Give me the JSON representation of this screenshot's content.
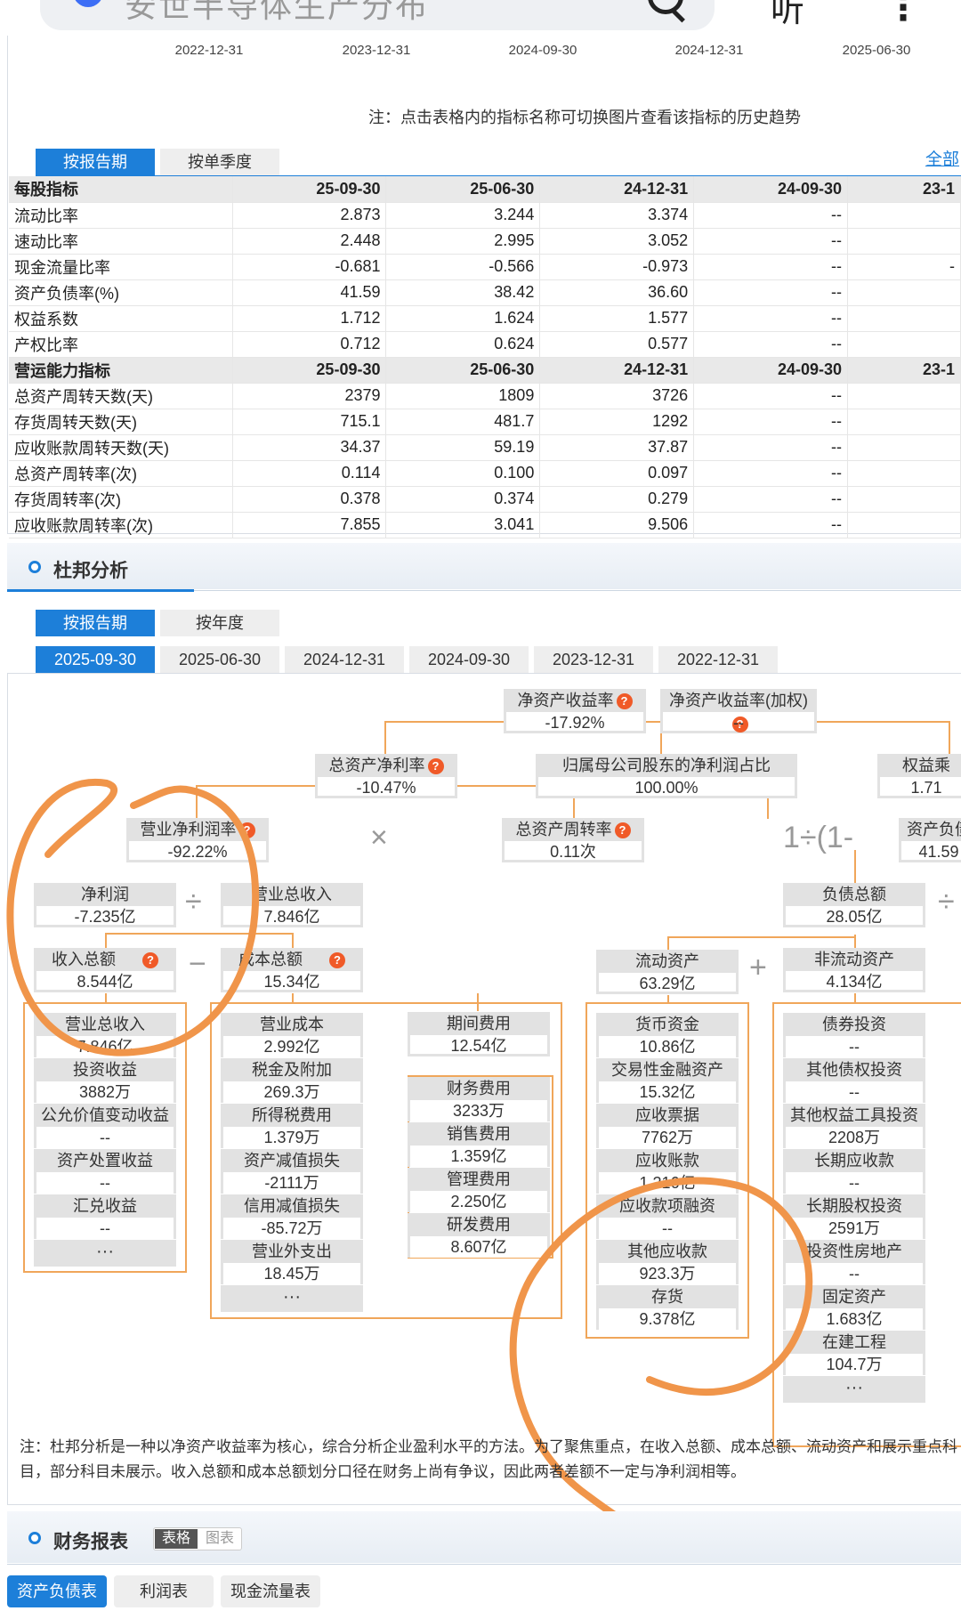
{
  "topbar": {
    "search_text": "安世半导体生产分布",
    "listen_label": "听"
  },
  "trend_dates": [
    "2022-12-31",
    "2023-12-31",
    "2024-09-30",
    "2024-12-31",
    "2025-06-30"
  ],
  "note1": "注：点击表格内的指标名称可切换图片查看该指标的历史趋势",
  "tabs_report": {
    "by_report": "按报告期",
    "by_quarter": "按单季度",
    "all": "全部"
  },
  "table": {
    "header": {
      "name": "每股指标",
      "cols": [
        "25-09-30",
        "25-06-30",
        "24-12-31",
        "24-09-30",
        "23-1"
      ]
    },
    "rows1": [
      {
        "name": "流动比率",
        "v": [
          "2.873",
          "3.244",
          "3.374",
          "--",
          ""
        ]
      },
      {
        "name": "速动比率",
        "v": [
          "2.448",
          "2.995",
          "3.052",
          "--",
          ""
        ]
      },
      {
        "name": "现金流量比率",
        "v": [
          "-0.681",
          "-0.566",
          "-0.973",
          "--",
          "-"
        ]
      },
      {
        "name": "资产负债率(%)",
        "v": [
          "41.59",
          "38.42",
          "36.60",
          "--",
          ""
        ]
      },
      {
        "name": "权益系数",
        "v": [
          "1.712",
          "1.624",
          "1.577",
          "--",
          ""
        ]
      },
      {
        "name": "产权比率",
        "v": [
          "0.712",
          "0.624",
          "0.577",
          "--",
          ""
        ]
      }
    ],
    "header2": {
      "name": "营运能力指标",
      "cols": [
        "25-09-30",
        "25-06-30",
        "24-12-31",
        "24-09-30",
        "23-1"
      ]
    },
    "rows2": [
      {
        "name": "总资产周转天数(天)",
        "v": [
          "2379",
          "1809",
          "3726",
          "--",
          ""
        ]
      },
      {
        "name": "存货周转天数(天)",
        "v": [
          "715.1",
          "481.7",
          "1292",
          "--",
          ""
        ]
      },
      {
        "name": "应收账款周转天数(天)",
        "v": [
          "34.37",
          "59.19",
          "37.87",
          "--",
          ""
        ]
      },
      {
        "name": "总资产周转率(次)",
        "v": [
          "0.114",
          "0.100",
          "0.097",
          "--",
          ""
        ]
      },
      {
        "name": "存货周转率(次)",
        "v": [
          "0.378",
          "0.374",
          "0.279",
          "--",
          ""
        ]
      },
      {
        "name": "应收账款周转率(次)",
        "v": [
          "7.855",
          "3.041",
          "9.506",
          "--",
          ""
        ]
      }
    ]
  },
  "dupont": {
    "title": "杜邦分析",
    "tab_report": "按报告期",
    "tab_year": "按年度",
    "dates": [
      "2025-09-30",
      "2025-06-30",
      "2024-12-31",
      "2024-09-30",
      "2023-12-31",
      "2022-12-31"
    ],
    "roe": {
      "label": "净资产收益率",
      "value": "-17.92%"
    },
    "roe_w": {
      "label": "净资产收益率(加权)",
      "value": "--"
    },
    "roa": {
      "label": "总资产净利率",
      "value": "-10.47%"
    },
    "parent_share": {
      "label": "归属母公司股东的净利润占比",
      "value": "100.00%"
    },
    "equity_mult": {
      "label": "权益乘",
      "value": "1.71"
    },
    "net_margin": {
      "label": "营业净利润率",
      "value": "-92.22%"
    },
    "asset_turn": {
      "label": "总资产周转率",
      "value": "0.11次"
    },
    "formula": "1÷(1-",
    "debt_ratio": {
      "label": "资产负债",
      "value": "41.59"
    },
    "net_profit": {
      "label": "净利润",
      "value": "-7.235亿"
    },
    "revenue": {
      "label": "营业总收入",
      "value": "7.846亿"
    },
    "total_liab": {
      "label": "负债总额",
      "value": "28.05亿"
    },
    "income_total": {
      "label": "收入总额",
      "value": "8.544亿"
    },
    "cost_total": {
      "label": "成本总额",
      "value": "15.34亿"
    },
    "current_assets": {
      "label": "流动资产",
      "value": "63.29亿"
    },
    "noncurrent_assets": {
      "label": "非流动资产",
      "value": "4.134亿"
    },
    "ops": {
      "times": "×",
      "div": "÷",
      "minus": "−",
      "plus": "+"
    },
    "income_items": [
      {
        "label": "营业总收入",
        "value": "7.846亿"
      },
      {
        "label": "投资收益",
        "value": "3882万"
      },
      {
        "label": "公允价值变动收益",
        "value": "--"
      },
      {
        "label": "资产处置收益",
        "value": "--"
      },
      {
        "label": "汇兑收益",
        "value": "--"
      }
    ],
    "cost_items": [
      {
        "label": "营业成本",
        "value": "2.992亿"
      },
      {
        "label": "税金及附加",
        "value": "269.3万"
      },
      {
        "label": "所得税费用",
        "value": "1.379万"
      },
      {
        "label": "资产减值损失",
        "value": "-2111万"
      },
      {
        "label": "信用减值损失",
        "value": "-85.72万"
      },
      {
        "label": "营业外支出",
        "value": "18.45万"
      }
    ],
    "period_expense": {
      "label": "期间费用",
      "value": "12.54亿"
    },
    "expense_items": [
      {
        "label": "财务费用",
        "value": "3233万"
      },
      {
        "label": "销售费用",
        "value": "1.359亿"
      },
      {
        "label": "管理费用",
        "value": "2.250亿"
      },
      {
        "label": "研发费用",
        "value": "8.607亿"
      }
    ],
    "current_items": [
      {
        "label": "货币资金",
        "value": "10.86亿"
      },
      {
        "label": "交易性金融资产",
        "value": "15.32亿"
      },
      {
        "label": "应收票据",
        "value": "7762万"
      },
      {
        "label": "应收账款",
        "value": "1.216亿"
      },
      {
        "label": "应收款项融资",
        "value": "--"
      },
      {
        "label": "其他应收款",
        "value": "923.3万"
      },
      {
        "label": "存货",
        "value": "9.378亿"
      }
    ],
    "noncurrent_items": [
      {
        "label": "债券投资",
        "value": "--"
      },
      {
        "label": "其他债权投资",
        "value": "--"
      },
      {
        "label": "其他权益工具投资",
        "value": "2208万"
      },
      {
        "label": "长期应收款",
        "value": "--"
      },
      {
        "label": "长期股权投资",
        "value": "2591万"
      },
      {
        "label": "投资性房地产",
        "value": "--"
      },
      {
        "label": "固定资产",
        "value": "1.683亿"
      },
      {
        "label": "在建工程",
        "value": "104.7万"
      }
    ],
    "more": "···",
    "note": "注：杜邦分析是一种以净资产收益率为核心，综合分析企业盈利水平的方法。为了聚焦重点，在收入总额、成本总额、流动资产和展示重点科目，部分科目未展示。收入总额和成本总额划分口径在财务上尚有争议，因此两者差额不一定与净利润相等。"
  },
  "finance": {
    "title": "财务报表",
    "toggle_table": "表格",
    "toggle_chart": "图表",
    "tabs": [
      "资产负债表",
      "利润表",
      "现金流量表"
    ]
  },
  "annotation_color": "#f0954a"
}
